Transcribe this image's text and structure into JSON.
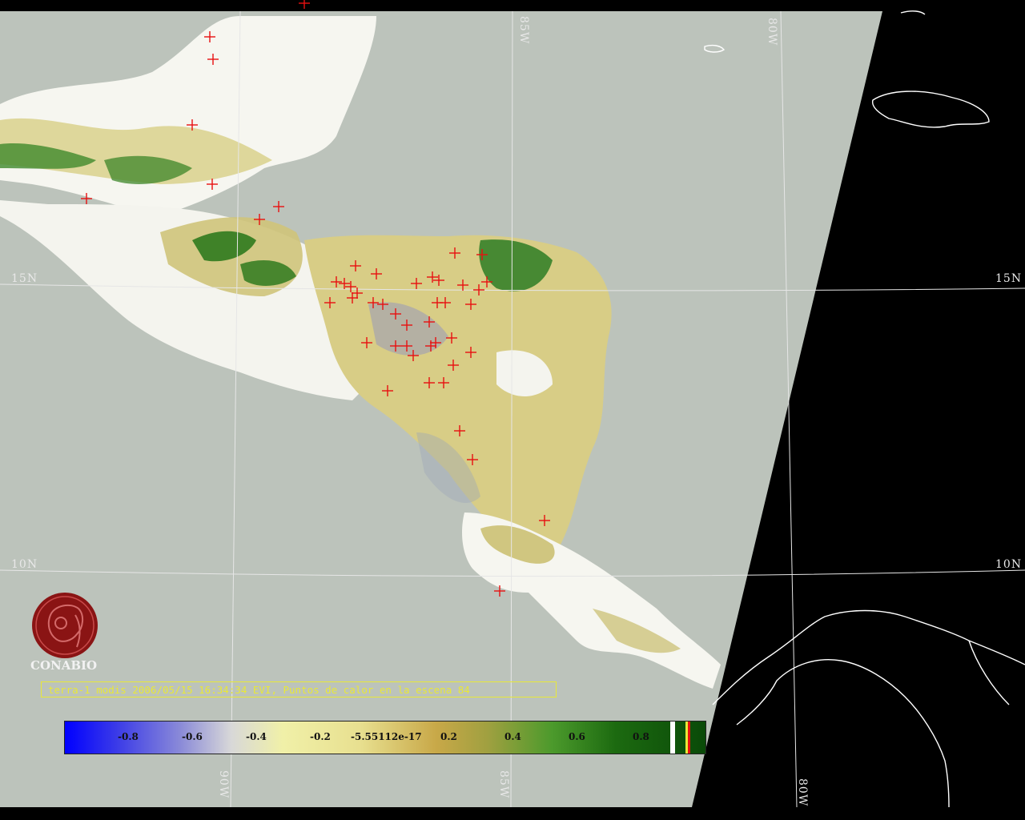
{
  "caption": "terra-1 modis 2006/05/15 16:34:34 EVI, Puntos de calor en la escena 84",
  "logo": {
    "text": "CONABIO"
  },
  "graticule": {
    "lat_labels": [
      "15N",
      "10N"
    ],
    "lon_labels": [
      "85W",
      "80W",
      "90W",
      "85W",
      "80W"
    ]
  },
  "colorbar": {
    "ticks": [
      "-0.8",
      "-0.6",
      "-0.4",
      "-0.2",
      "-5.55112e-17",
      "0.2",
      "0.4",
      "0.6",
      "0.8"
    ]
  },
  "colors": {
    "background_gray": "#bcc3bb",
    "no_data": "#000000",
    "hotspot": "#e81010",
    "coastline": "#ffffff",
    "caption": "#e8e838"
  },
  "hotspot_marker": "red-cross",
  "hotspot_count_in_scene": 84
}
